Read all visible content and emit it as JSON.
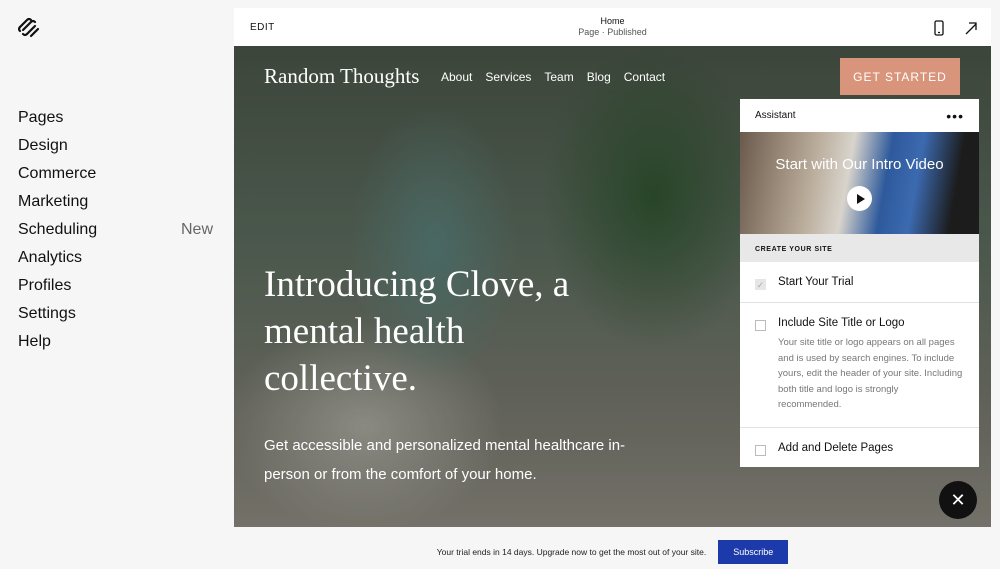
{
  "sidebar": {
    "items": [
      {
        "label": "Pages"
      },
      {
        "label": "Design"
      },
      {
        "label": "Commerce"
      },
      {
        "label": "Marketing"
      },
      {
        "label": "Scheduling",
        "badge": "New"
      },
      {
        "label": "Analytics"
      },
      {
        "label": "Profiles"
      },
      {
        "label": "Settings"
      },
      {
        "label": "Help"
      }
    ]
  },
  "topbar": {
    "edit": "EDIT",
    "page_title": "Home",
    "page_status": "Page · Published",
    "icons": [
      "mobile-icon",
      "external-arrow-icon"
    ]
  },
  "site": {
    "title": "Random Thoughts",
    "nav": [
      "About",
      "Services",
      "Team",
      "Blog",
      "Contact"
    ],
    "cta": "GET STARTED",
    "cta_color": "#d9957c",
    "headline": "Introducing Clove, a mental health collective.",
    "subline": "Get accessible and personalized mental healthcare in-person or from the comfort of your home."
  },
  "assistant": {
    "title": "Assistant",
    "video_title": "Start with Our Intro Video",
    "section": "CREATE YOUR SITE",
    "steps": [
      {
        "title": "Start Your Trial",
        "done": true
      },
      {
        "title": "Include Site Title or Logo",
        "done": false,
        "desc": "Your site title or logo appears on all pages and is used by search engines. To include yours, edit the header of your site. Including both title and logo is strongly recommended."
      },
      {
        "title": "Add and Delete Pages",
        "done": false
      }
    ]
  },
  "trial": {
    "message": "Your trial ends in 14 days. Upgrade now to get the most out of your site.",
    "button": "Subscribe",
    "button_color": "#1c3aa9"
  }
}
